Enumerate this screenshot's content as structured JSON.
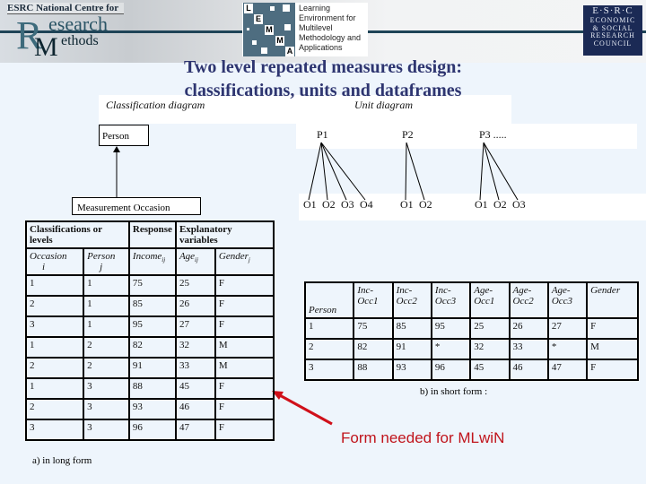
{
  "header": {
    "ncrm": {
      "top_line": "ESRC National Centre for",
      "r_letter": "R",
      "m_letter": "M",
      "esearch": "esearch",
      "ethods": "ethods"
    },
    "lemma": {
      "letters": [
        "L",
        "E",
        "M",
        "M",
        "A"
      ],
      "lines": [
        "Learning",
        "Environment for",
        "Multilevel",
        "Methodology and",
        "Applications"
      ]
    },
    "esrc": {
      "line1": "E·S·R·C",
      "line2": "ECONOMIC",
      "line3": "& SOCIAL",
      "line4": "RESEARCH",
      "line5": "COUNCIL"
    }
  },
  "title": {
    "line1": "Two level repeated measures design:",
    "line2": "classifications, units and dataframes"
  },
  "classification_diagram": {
    "label": "Classification diagram",
    "top_node": "Person",
    "bottom_node": "Measurement Occasion"
  },
  "unit_diagram": {
    "label": "Unit diagram",
    "persons": [
      {
        "label": "P1",
        "occasions": [
          "O1",
          "O2",
          "O3",
          "O4"
        ]
      },
      {
        "label": "P2",
        "occasions": [
          "O1",
          "O2"
        ]
      },
      {
        "label": "P3 .....",
        "occasions": [
          "O1",
          "O2",
          "O3"
        ]
      }
    ]
  },
  "long_form": {
    "group_headers": [
      "Classifications or levels",
      "Response",
      "Explanatory variables"
    ],
    "col_headers": [
      {
        "name": "Occasion",
        "sub": "i"
      },
      {
        "name": "Person",
        "sub": "j"
      },
      {
        "name": "Income",
        "sub": "ij"
      },
      {
        "name": "Age",
        "sub": "ij"
      },
      {
        "name": "Gender",
        "sub": "j"
      }
    ],
    "rows": [
      [
        "1",
        "1",
        "75",
        "25",
        "F"
      ],
      [
        "2",
        "1",
        "85",
        "26",
        "F"
      ],
      [
        "3",
        "1",
        "95",
        "27",
        "F"
      ],
      [
        "1",
        "2",
        "82",
        "32",
        "M"
      ],
      [
        "2",
        "2",
        "91",
        "33",
        "M"
      ],
      [
        "1",
        "3",
        "88",
        "45",
        "F"
      ],
      [
        "2",
        "3",
        "93",
        "46",
        "F"
      ],
      [
        "3",
        "3",
        "96",
        "47",
        "F"
      ]
    ],
    "caption": "a) in long form"
  },
  "short_form": {
    "col_headers": [
      "Person",
      "Inc-Occ1",
      "Inc-Occ2",
      "Inc-Occ3",
      "Age-Occ1",
      "Age-Occ2",
      "Age-Occ3",
      "Gender"
    ],
    "rows": [
      [
        "1",
        "75",
        "85",
        "95",
        "25",
        "26",
        "27",
        "F"
      ],
      [
        "2",
        "82",
        "91",
        "*",
        "32",
        "33",
        "*",
        "M"
      ],
      [
        "3",
        "88",
        "93",
        "96",
        "45",
        "46",
        "47",
        "F"
      ]
    ],
    "caption": "b) in short form :"
  },
  "annotation": {
    "text": "Form needed for MLwiN",
    "color": "#c0141c"
  }
}
